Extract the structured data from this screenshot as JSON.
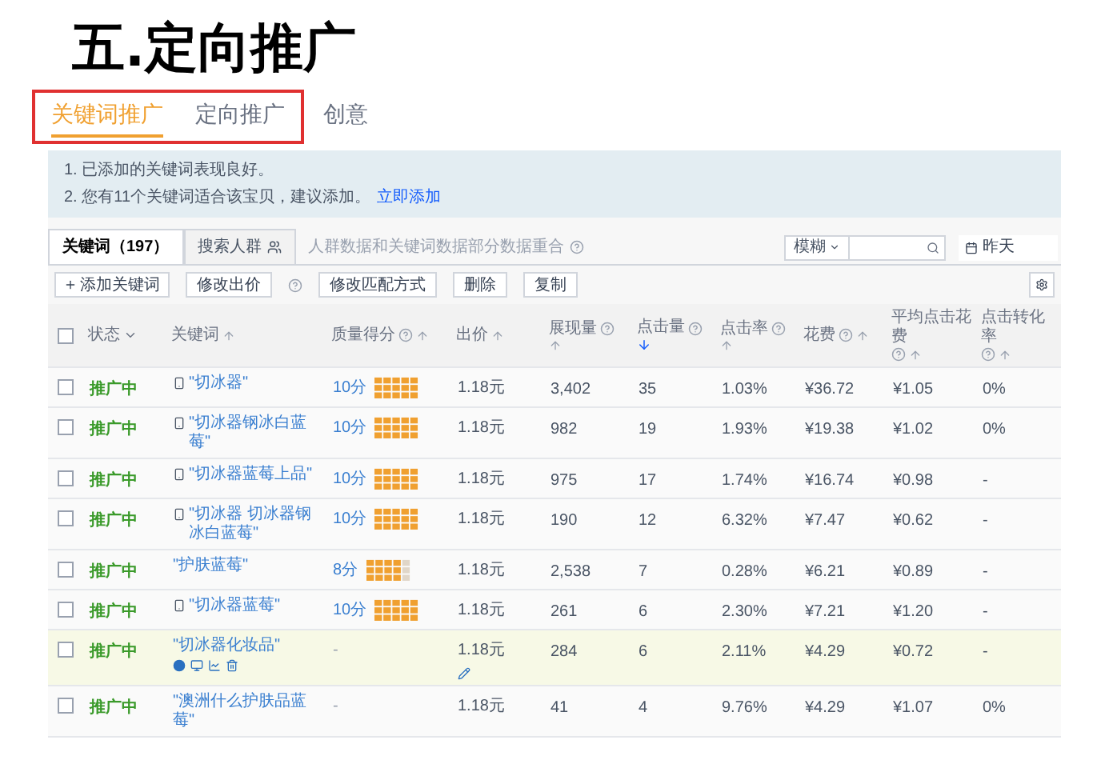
{
  "heading": "五.定向推广",
  "tabs": [
    {
      "label": "关键词推广",
      "selected": true,
      "framed": true
    },
    {
      "label": "定向推广",
      "selected": false,
      "framed": true
    },
    {
      "label": "创意",
      "selected": false,
      "framed": false
    }
  ],
  "notice": {
    "lines": [
      "1. 已添加的关键词表现良好。",
      "2. 您有11个关键词适合该宝贝，建议添加。"
    ],
    "link": "立即添加"
  },
  "subtabs": [
    {
      "label": "关键词（197）",
      "selected": true,
      "icon": false
    },
    {
      "label": "搜索人群",
      "selected": false,
      "icon": true
    }
  ],
  "subtab_hint": "人群数据和关键词数据部分数据重合",
  "match_dropdown": "模糊",
  "date_button": "昨天",
  "toolbar": [
    {
      "label": "添加关键词",
      "kind": "add"
    },
    {
      "label": "修改出价",
      "kind": "plain"
    },
    {
      "kind": "help"
    },
    {
      "label": "修改匹配方式",
      "kind": "plain"
    },
    {
      "label": "删除",
      "kind": "plain"
    },
    {
      "label": "复制",
      "kind": "plain"
    }
  ],
  "select_all": {
    "checked": false
  },
  "columns": [
    {
      "label": "状态",
      "help": false,
      "kind": "menu"
    },
    {
      "label": "关键词",
      "help": false,
      "kind": "sortable",
      "sorted": false
    },
    {
      "label": "质量得分",
      "help": true,
      "kind": "sortable",
      "sorted": false
    },
    {
      "label": "出价",
      "help": false,
      "kind": "sortable",
      "sorted": false
    },
    {
      "label": "展现量",
      "help": true,
      "kind": "sortable",
      "sorted": false
    },
    {
      "label": "点击量",
      "help": true,
      "kind": "sortable",
      "sorted": true
    },
    {
      "label": "点击率",
      "help": true,
      "kind": "sortable",
      "sorted": false
    },
    {
      "label": "花费",
      "help": true,
      "kind": "sortable",
      "sorted": false
    },
    {
      "label": "平均点击花费",
      "help": true,
      "kind": "sortable",
      "sorted": false
    },
    {
      "label": "点击转化率",
      "help": true,
      "kind": "sortable",
      "sorted": false
    }
  ],
  "rows": [
    {
      "checked": false,
      "highlighted": false,
      "status": "推广中",
      "mobile": true,
      "keyword": "\"切冰器\"",
      "tools": false,
      "score": "10分",
      "level": 1,
      "bid": "1.18元",
      "edit": false,
      "impressions": "3,402",
      "clicks": "35",
      "ctr": "1.03%",
      "cost": "¥36.72",
      "cpc": "¥1.05",
      "conversion": "0%"
    },
    {
      "checked": false,
      "highlighted": false,
      "status": "推广中",
      "mobile": true,
      "keyword": "\"切冰器钢冰白蓝莓\"",
      "tools": false,
      "score": "10分",
      "level": 1,
      "bid": "1.18元",
      "edit": false,
      "impressions": "982",
      "clicks": "19",
      "ctr": "1.93%",
      "cost": "¥19.38",
      "cpc": "¥1.02",
      "conversion": "0%"
    },
    {
      "checked": false,
      "highlighted": false,
      "status": "推广中",
      "mobile": true,
      "keyword": "\"切冰器蓝莓上品\"",
      "tools": false,
      "score": "10分",
      "level": 1,
      "bid": "1.18元",
      "edit": false,
      "impressions": "975",
      "clicks": "17",
      "ctr": "1.74%",
      "cost": "¥16.74",
      "cpc": "¥0.98",
      "conversion": "-"
    },
    {
      "checked": false,
      "highlighted": false,
      "status": "推广中",
      "mobile": true,
      "keyword": "\"切冰器 切冰器钢冰白蓝莓\"",
      "tools": false,
      "score": "10分",
      "level": 1,
      "bid": "1.18元",
      "edit": false,
      "impressions": "190",
      "clicks": "12",
      "ctr": "6.32%",
      "cost": "¥7.47",
      "cpc": "¥0.62",
      "conversion": "-"
    },
    {
      "checked": false,
      "highlighted": false,
      "status": "推广中",
      "mobile": false,
      "keyword": "\"护肤蓝莓\"",
      "tools": false,
      "score": "8分",
      "level": 0.8,
      "bid": "1.18元",
      "edit": false,
      "impressions": "2,538",
      "clicks": "7",
      "ctr": "0.28%",
      "cost": "¥6.21",
      "cpc": "¥0.89",
      "conversion": "-"
    },
    {
      "checked": false,
      "highlighted": false,
      "status": "推广中",
      "mobile": true,
      "keyword": "\"切冰器蓝莓\"",
      "tools": false,
      "score": "10分",
      "level": 1,
      "bid": "1.18元",
      "edit": false,
      "impressions": "261",
      "clicks": "6",
      "ctr": "2.30%",
      "cost": "¥7.21",
      "cpc": "¥1.20",
      "conversion": "-"
    },
    {
      "checked": false,
      "highlighted": true,
      "status": "推广中",
      "mobile": false,
      "keyword": "\"切冰器化妆品\"",
      "tools": true,
      "score": "-",
      "bid": "1.18元",
      "edit": true,
      "impressions": "284",
      "clicks": "6",
      "ctr": "2.11%",
      "cost": "¥4.29",
      "cpc": "¥0.72",
      "conversion": "-"
    },
    {
      "checked": false,
      "highlighted": false,
      "status": "推广中",
      "mobile": false,
      "keyword": "\"澳洲什么护肤品蓝莓\"",
      "tools": false,
      "score": "-",
      "bid": "1.18元",
      "edit": false,
      "impressions": "41",
      "clicks": "4",
      "ctr": "9.76%",
      "cost": "¥4.29",
      "cpc": "¥1.07",
      "conversion": "0%"
    }
  ]
}
